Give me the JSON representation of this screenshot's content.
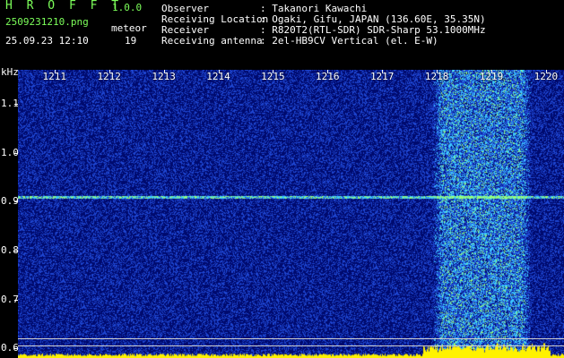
{
  "header": {
    "app_title": "H R O F F T",
    "version": "1.0.0",
    "file_name": "2509231210.png",
    "date_time": "25.09.23 12:10",
    "event_label": "meteor",
    "event_count": "19"
  },
  "station_info": [
    {
      "label": "Observer",
      "value": ": Takanori Kawachi"
    },
    {
      "label": "Receiving Location",
      "value": ": Ogaki, Gifu, JAPAN (136.60E, 35.35N)"
    },
    {
      "label": "Receiver",
      "value": ": R820T2(RTL-SDR) SDR-Sharp 53.1000MHz"
    },
    {
      "label": "Receiving antenna",
      "value": ": 2el-HB9CV Vertical (el. E-W)"
    }
  ],
  "axes": {
    "freq_unit": "kHz",
    "freq_ticks": [
      "1.1",
      "1.0",
      "0.9",
      "0.8",
      "0.7",
      "0.6"
    ],
    "freq_values": [
      1.1,
      1.0,
      0.9,
      0.8,
      0.7,
      0.6
    ],
    "freq_range": [
      0.58,
      1.17
    ],
    "minute_ticks": [
      "1211",
      "1212",
      "1213",
      "1214",
      "1215",
      "1216",
      "1217",
      "1218",
      "1219",
      "1220"
    ],
    "minute_values": [
      1211,
      1212,
      1213,
      1214,
      1215,
      1216,
      1217,
      1218,
      1219,
      1220
    ],
    "minute_range": [
      1210.33,
      1220.33
    ]
  },
  "colors": {
    "background": "#000a66",
    "noise": "#1f3ccc",
    "signal": "#6fe0ff",
    "label_green": "#7cff5a",
    "peak_yellow": "#fff200"
  },
  "chart_data": {
    "type": "heatmap",
    "x_label": "",
    "y_label": "kHz",
    "xlim": [
      1210.33,
      1220.33
    ],
    "ylim": [
      0.58,
      1.17
    ],
    "carrier_frequency": 0.91,
    "noise_band": {
      "minute_start": 1217.9,
      "minute_end": 1219.75
    },
    "guide_lines_khz": [
      0.62,
      0.605
    ]
  }
}
